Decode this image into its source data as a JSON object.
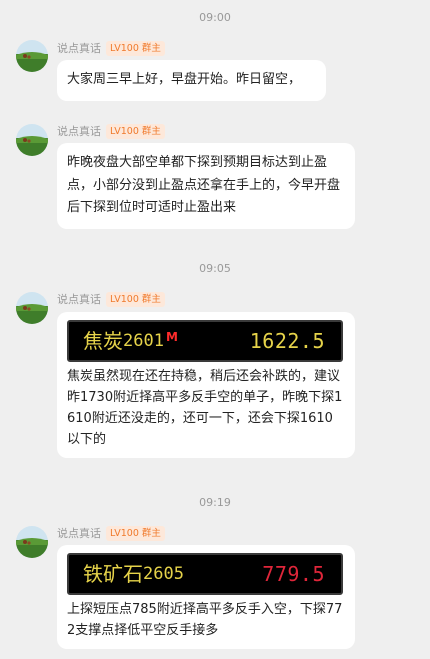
{
  "sender": {
    "name": "说点真话",
    "badge": "LV100 群主"
  },
  "timestamps": [
    "09:00",
    "09:05",
    "09:19"
  ],
  "messages": [
    {
      "text": "大家周三早上好，早盘开始。昨日留空，"
    },
    {
      "text": "昨晚夜盘大部空单都下探到预期目标达到止盈点，小部分没到止盈点还拿在手上的，今早开盘后下探到位时可适时止盈出来"
    },
    {
      "quote": {
        "name": "焦炭",
        "code": "2601",
        "flag": "M",
        "price": "1622.5",
        "price_color": "#e6d34a"
      },
      "text": "焦炭虽然现在还在持稳，稍后还会补跌的，建议昨1730附近择高平多反手空的单子，昨晚下探1610附近还没走的，还可一下，还会下探1610以下的"
    },
    {
      "quote": {
        "name": "铁矿石",
        "code": "2605",
        "price": "779.5",
        "price_color": "#e0263a"
      },
      "text": "上探短压点785附近择高平多反手入空，下探772支撑点择低平空反手接多"
    }
  ]
}
